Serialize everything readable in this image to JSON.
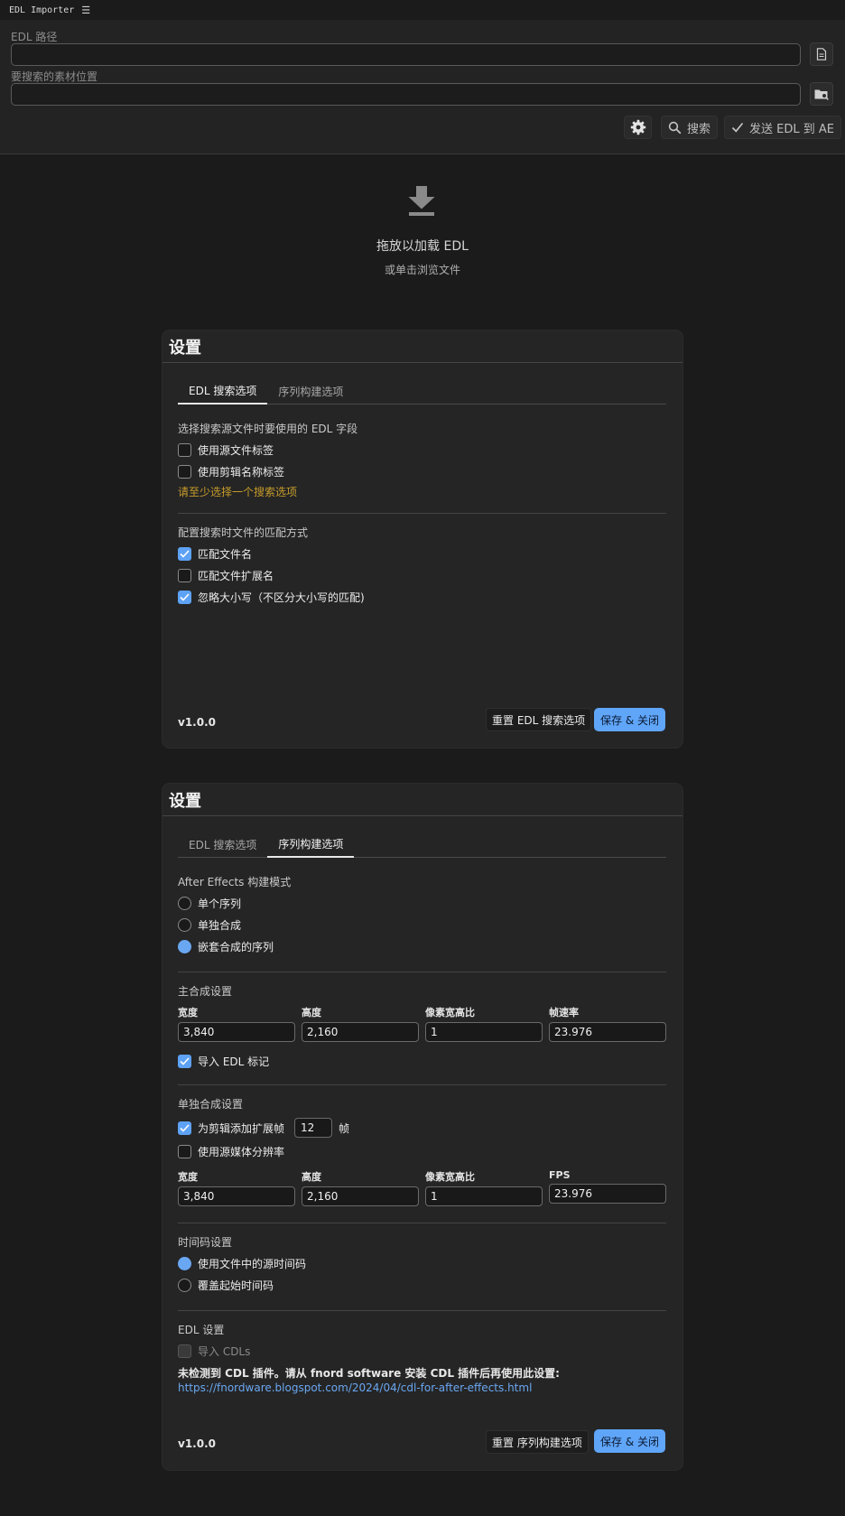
{
  "titlebar": {
    "title": "EDL Importer",
    "menu_icon": "☰"
  },
  "inputs": {
    "edl_path_label": "EDL 路径",
    "edl_path_value": "",
    "search_location_label": "要搜索的素材位置",
    "search_location_value": ""
  },
  "toolbar": {
    "search_label": "搜索",
    "send_label": "发送 EDL 到 AE"
  },
  "dropzone": {
    "title": "拖放以加载 EDL",
    "subtitle": "或单击浏览文件"
  },
  "colors": {
    "accent": "#5fa5f8",
    "warning": "#c69c2a",
    "background": "#1b1b1b",
    "card": "#252525"
  },
  "panel1": {
    "title": "设置",
    "tabs": [
      {
        "label": "EDL 搜索选项"
      },
      {
        "label": "序列构建选项"
      }
    ],
    "active_tab": 0,
    "section1_label": "选择搜索源文件时要使用的 EDL 字段",
    "opt_source_tag": {
      "label": "使用源文件标签",
      "checked": false
    },
    "opt_clip_tag": {
      "label": "使用剪辑名称标签",
      "checked": false
    },
    "warning": "请至少选择一个搜索选项",
    "section2_label": "配置搜索时文件的匹配方式",
    "opt_match_name": {
      "label": "匹配文件名",
      "checked": true
    },
    "opt_match_ext": {
      "label": "匹配文件扩展名",
      "checked": false
    },
    "opt_ignore_case": {
      "label": "忽略大小写（不区分大小写的匹配)",
      "checked": true
    },
    "version": "v1.0.0",
    "reset_label": "重置 EDL 搜索选项",
    "save_label": "保存 & 关闭"
  },
  "panel2": {
    "title": "设置",
    "tabs": [
      {
        "label": "EDL 搜索选项"
      },
      {
        "label": "序列构建选项"
      }
    ],
    "active_tab": 1,
    "build_mode_label": "After Effects 构建模式",
    "modes": [
      {
        "label": "单个序列",
        "checked": false
      },
      {
        "label": "单独合成",
        "checked": false
      },
      {
        "label": "嵌套合成的序列",
        "checked": true
      }
    ],
    "main_comp_label": "主合成设置",
    "main_fields": [
      {
        "label": "宽度",
        "value": "3,840"
      },
      {
        "label": "高度",
        "value": "2,160"
      },
      {
        "label": "像素宽高比",
        "value": "1"
      },
      {
        "label": "帧速率",
        "value": "23.976"
      }
    ],
    "import_markers": {
      "label": "导入 EDL 标记",
      "checked": true
    },
    "single_comp_label": "单独合成设置",
    "add_handles": {
      "label": "为剪辑添加扩展帧",
      "checked": true,
      "value": "12",
      "unit": "帧"
    },
    "use_source_res": {
      "label": "使用源媒体分辨率",
      "checked": false
    },
    "single_fields": [
      {
        "label": "宽度",
        "value": "3,840"
      },
      {
        "label": "高度",
        "value": "2,160"
      },
      {
        "label": "像素宽高比",
        "value": "1"
      },
      {
        "label": "FPS",
        "value": "23.976"
      }
    ],
    "timecode_label": "时间码设置",
    "timecode_options": [
      {
        "label": "使用文件中的源时间码",
        "checked": true
      },
      {
        "label": "覆盖起始时间码",
        "checked": false
      }
    ],
    "edl_settings_label": "EDL 设置",
    "import_cdls": {
      "label": "导入 CDLs",
      "checked": false,
      "disabled": true
    },
    "cdl_note": "未检测到 CDL 插件。请从 fnord software 安装 CDL 插件后再使用此设置:",
    "cdl_link": "https://fnordware.blogspot.com/2024/04/cdl-for-after-effects.html",
    "version": "v1.0.0",
    "reset_label": "重置 序列构建选项",
    "save_label": "保存 & 关闭"
  }
}
